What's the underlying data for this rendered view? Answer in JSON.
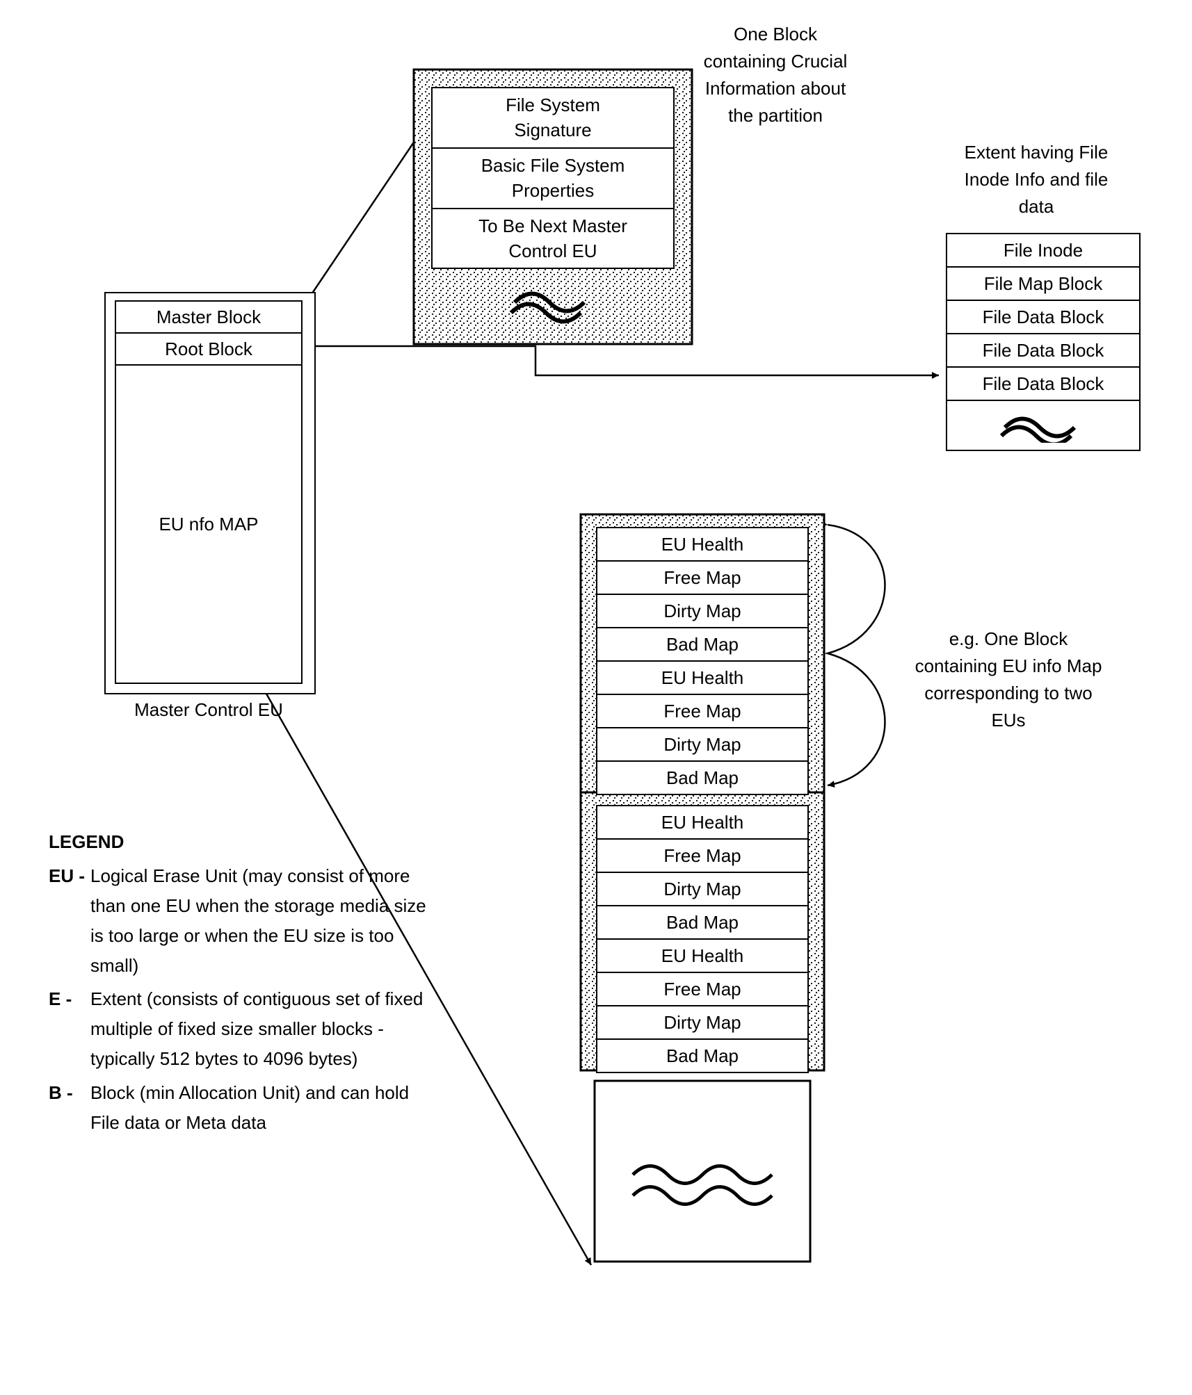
{
  "master_control": {
    "caption": "Master Control EU",
    "items": [
      "Master Block",
      "Root Block",
      "EU nfo MAP"
    ]
  },
  "master_block_detail": {
    "rows": [
      "File System\nSignature",
      "Basic File System\nProperties",
      "To Be Next Master\nControl EU"
    ],
    "annotation": "One Block containing Crucial Information about the partition"
  },
  "file_extent": {
    "annotation": "Extent having File Inode Info and file data",
    "rows": [
      "File Inode",
      "File Map Block",
      "File Data Block",
      "File Data Block",
      "File Data Block"
    ]
  },
  "eu_info_map": {
    "annotation": "e.g. One Block containing EU info Map corresponding to two EUs",
    "rows": [
      "EU Health",
      "Free Map",
      "Dirty Map",
      "Bad Map",
      "EU Health",
      "Free Map",
      "Dirty Map",
      "Bad Map",
      "EU Health",
      "Free Map",
      "Dirty Map",
      "Bad Map",
      "EU Health",
      "Free Map",
      "Dirty Map",
      "Bad Map"
    ]
  },
  "legend": {
    "title": "LEGEND",
    "items": [
      {
        "key": "EU -",
        "desc": "Logical Erase Unit (may consist of more than one EU when the storage media size is too large or when the EU size is too small)"
      },
      {
        "key": "E -",
        "desc": "Extent (consists of contiguous set of fixed multiple of fixed size smaller blocks - typically 512 bytes to 4096 bytes)"
      },
      {
        "key": "B -",
        "desc": "Block (min Allocation Unit) and can hold File data or Meta data"
      }
    ]
  }
}
